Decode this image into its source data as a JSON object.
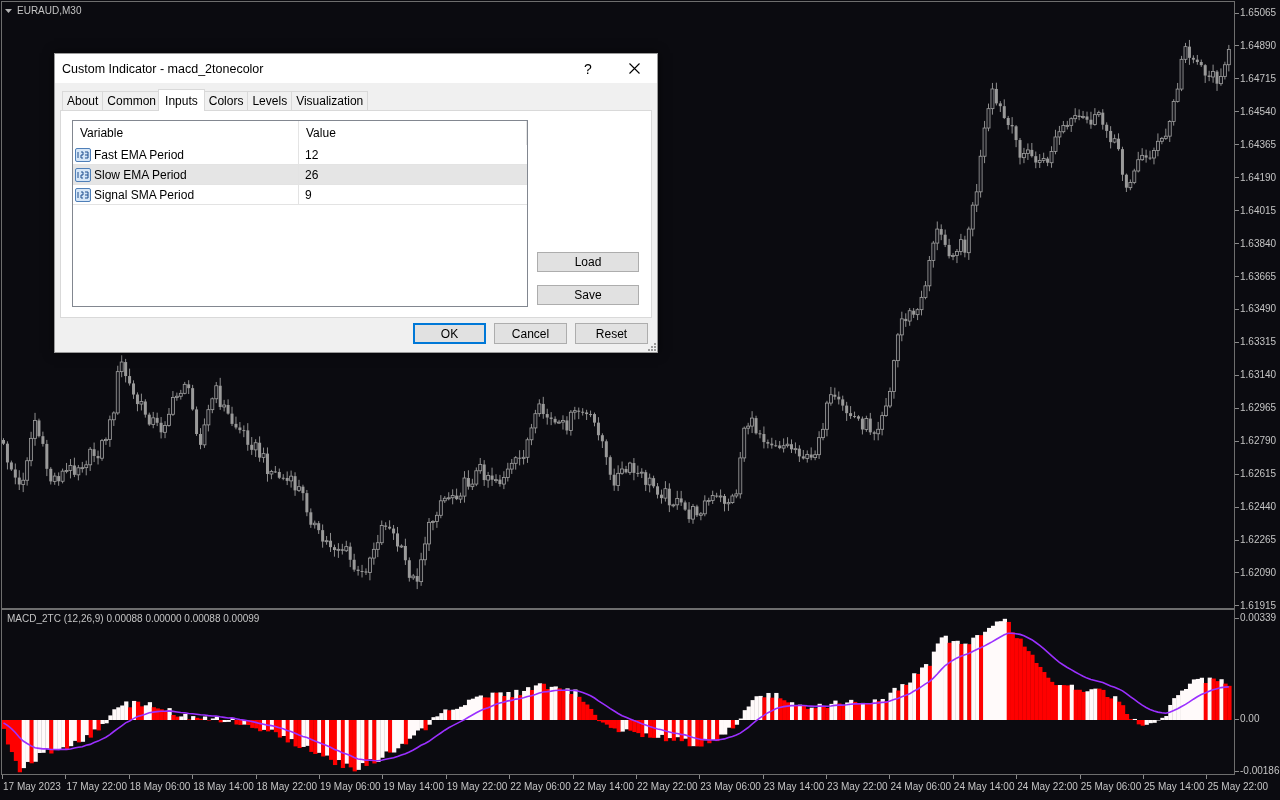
{
  "chart": {
    "symbol": "EURAUD,M30",
    "price_axis": [
      "1.65065",
      "1.64890",
      "1.64715",
      "1.64540",
      "1.64365",
      "1.64190",
      "1.64015",
      "1.63840",
      "1.63665",
      "1.63490",
      "1.63315",
      "1.63140",
      "1.62965",
      "1.62790",
      "1.62615",
      "1.62440",
      "1.62265",
      "1.62090",
      "1.61915"
    ]
  },
  "indicator": {
    "label": "MACD_2TC (12,26,9) 0.00088 0.00000 0.00088 0.00099",
    "axis": [
      "0.00339",
      "0.00",
      "-0.00186"
    ]
  },
  "time_axis": [
    "17 May 2023",
    "17 May 22:00",
    "18 May 06:00",
    "18 May 14:00",
    "18 May 22:00",
    "19 May 06:00",
    "19 May 14:00",
    "19 May 22:00",
    "22 May 06:00",
    "22 May 14:00",
    "22 May 22:00",
    "23 May 06:00",
    "23 May 14:00",
    "23 May 22:00",
    "24 May 06:00",
    "24 May 14:00",
    "24 May 22:00",
    "25 May 06:00",
    "25 May 14:00",
    "25 May 22:00"
  ],
  "dialog": {
    "title": "Custom Indicator - macd_2tonecolor",
    "help_button": "?",
    "tabs": [
      {
        "label": "About",
        "selected": false
      },
      {
        "label": "Common",
        "selected": false
      },
      {
        "label": "Inputs",
        "selected": true
      },
      {
        "label": "Colors",
        "selected": false
      },
      {
        "label": "Levels",
        "selected": false
      },
      {
        "label": "Visualization",
        "selected": false
      }
    ],
    "table": {
      "columns": [
        "Variable",
        "Value"
      ],
      "rows": [
        {
          "name": "Fast EMA Period",
          "value": "12",
          "selected": false
        },
        {
          "name": "Slow EMA Period",
          "value": "26",
          "selected": true
        },
        {
          "name": "Signal SMA Period",
          "value": "9",
          "selected": false
        }
      ]
    },
    "side_buttons": [
      "Load",
      "Save"
    ],
    "buttons": [
      {
        "label": "OK",
        "default": true
      },
      {
        "label": "Cancel",
        "default": false
      },
      {
        "label": "Reset",
        "default": false
      }
    ]
  }
}
